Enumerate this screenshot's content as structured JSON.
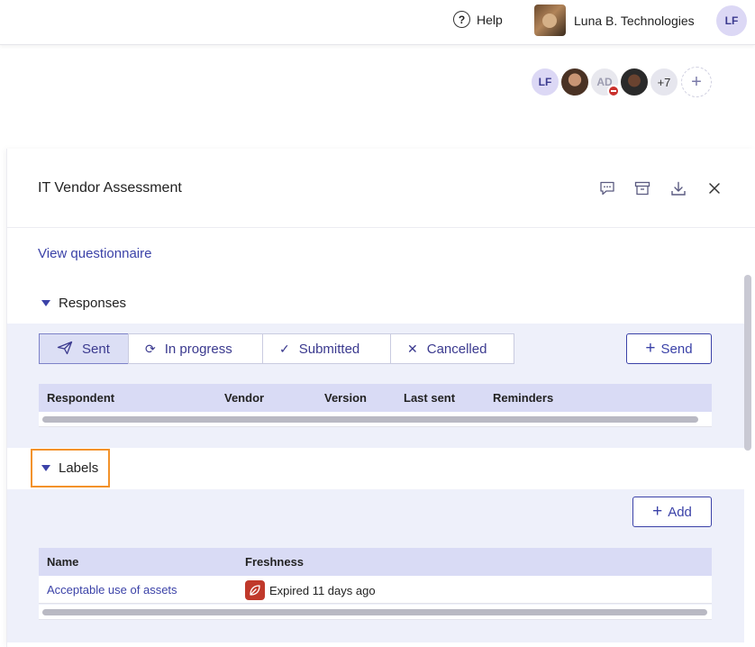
{
  "topbar": {
    "help_label": "Help",
    "help_icon": "?",
    "org_name": "Luna B. Technologies",
    "user_initials": "LF"
  },
  "collaborators": {
    "first_initials": "LF",
    "third_initials": "AD",
    "more_count": "+7",
    "add_symbol": "+"
  },
  "panel": {
    "title": "IT Vendor Assessment",
    "view_questionnaire": "View questionnaire",
    "responses": {
      "heading": "Responses",
      "tabs": [
        {
          "label": "Sent",
          "icon": "paper-plane-icon",
          "glyph": "➤"
        },
        {
          "label": "In progress",
          "icon": "refresh-icon",
          "glyph": "⟳"
        },
        {
          "label": "Submitted",
          "icon": "check-icon",
          "glyph": "✓"
        },
        {
          "label": "Cancelled",
          "icon": "x-icon",
          "glyph": "✕"
        }
      ],
      "send_label": "Send",
      "columns": [
        "Respondent",
        "Vendor",
        "Version",
        "Last sent",
        "Reminders"
      ]
    },
    "labels": {
      "heading": "Labels",
      "add_label": "Add",
      "columns": [
        "Name",
        "Freshness"
      ],
      "rows": [
        {
          "name": "Acceptable use of assets",
          "freshness": "Expired 11 days ago"
        }
      ]
    }
  },
  "colors": {
    "accent": "#3b42a8",
    "band": "#eef0fa",
    "table_header": "#d9dbf5",
    "highlight": "#f3922a",
    "expired": "#c0392b"
  }
}
